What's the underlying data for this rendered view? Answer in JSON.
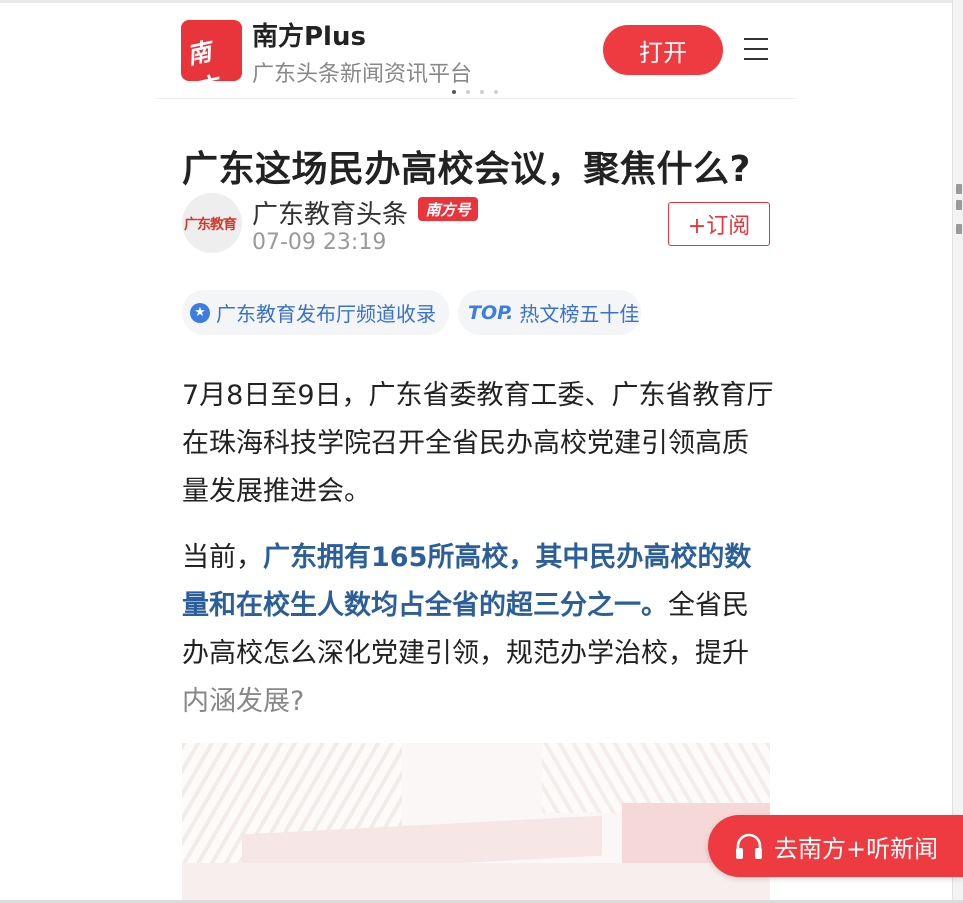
{
  "header": {
    "logo_text": "南方+",
    "app_name": "南方Plus",
    "app_subtitle": "广东头条新闻资讯平台",
    "open_button": "打开"
  },
  "article": {
    "title": "广东这场民办高校会议，聚焦什么?",
    "author": {
      "avatar_text": "广东教育",
      "name": "广东教育头条",
      "badge": "南方号",
      "time": "07-09 23:19",
      "subscribe": "+订阅"
    },
    "tags": [
      {
        "label": "广东教育发布厅频道收录"
      },
      {
        "prefix": "TOP.",
        "label": "热文榜五十佳"
      }
    ],
    "paragraphs": {
      "p1": "7月8日至9日，广东省委教育工委、广东省教育厅在珠海科技学院召开全省民办高校党建引领高质量发展推进会。",
      "p2_lead": "当前，",
      "p2_highlight": "广东拥有165所高校，其中民办高校的数量和在校生人数均占全省的超三分之一。",
      "p2_rest": "全省民办高校怎么深化党建引领，规范办学治校，提升",
      "p2_faded": "内涵发展?"
    }
  },
  "floating": {
    "listen_label": "去南方+听新闻"
  },
  "colors": {
    "brand_red": "#e8353b",
    "link_blue": "#3a72c9",
    "highlight_blue": "#2c5f9a"
  }
}
